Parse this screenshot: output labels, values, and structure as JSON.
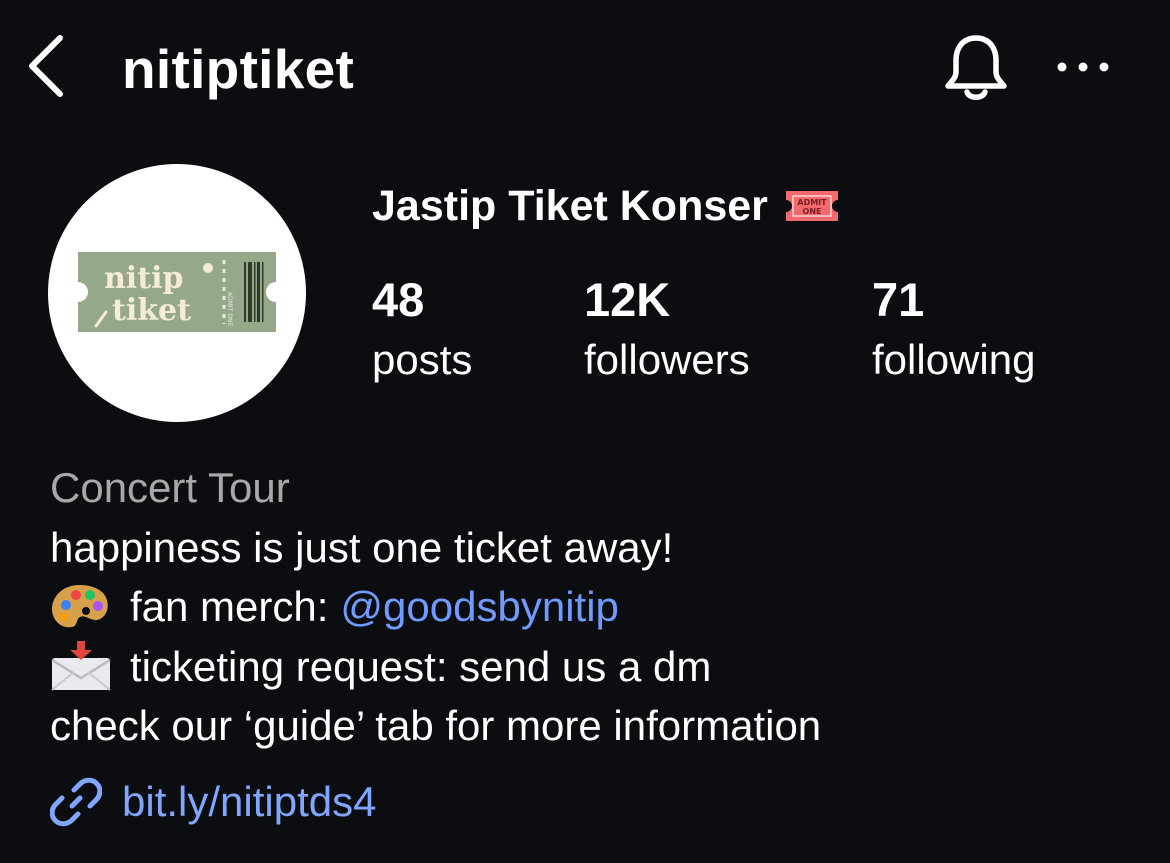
{
  "header": {
    "username": "nitiptiket",
    "back_icon": "chevron-left-icon",
    "bell_icon": "bell-icon",
    "more_icon": "more-horizontal-icon"
  },
  "profile": {
    "display_name": "Jastip Tiket Konser",
    "name_emoji": "admit-one-ticket-icon",
    "avatar_text": {
      "line1": "nitip",
      "line2": "tiket",
      "stub_text": "ADMIT ONE"
    }
  },
  "stats": {
    "posts": {
      "value": "48",
      "label": "posts"
    },
    "followers": {
      "value": "12K",
      "label": "followers"
    },
    "following": {
      "value": "71",
      "label": "following"
    }
  },
  "bio": {
    "category": "Concert Tour",
    "line1": "happiness is just one ticket away!",
    "line2_prefix": "fan merch:",
    "line2_mention": "@goodsbynitip",
    "line2_icon": "artist-palette-icon",
    "line3": "ticketing request: send us a dm",
    "line3_icon": "envelope-arrow-icon",
    "line4": "check our ‘guide’ tab for more information"
  },
  "link": {
    "text": "bit.ly/nitiptds4",
    "icon": "link-icon"
  },
  "colors": {
    "background": "#0b0d10",
    "text": "#ffffff",
    "category": "#a8a8a8",
    "link": "#7fa7ff",
    "avatar_ticket": "#95a98a",
    "admit_ticket": "#f06a6e"
  }
}
